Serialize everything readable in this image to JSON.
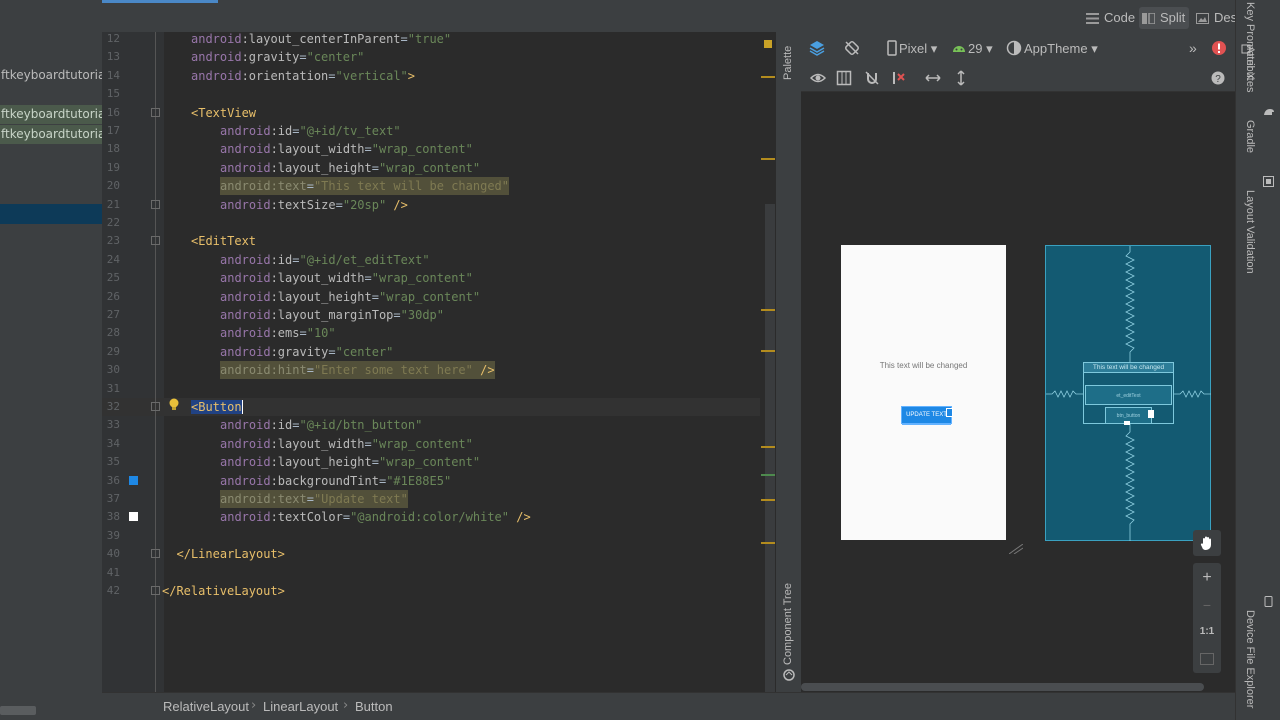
{
  "project_panel": {
    "items": [
      "ftkeyboardtutorial",
      "ftkeyboardtutorial",
      "ftkeyboardtutorial"
    ]
  },
  "view_modes": {
    "code": "Code",
    "split": "Split",
    "design": "Design",
    "active": "Split"
  },
  "editor": {
    "lines": [
      {
        "n": "12",
        "indent": 1,
        "parts": [
          [
            "ns",
            "android"
          ],
          [
            "attr",
            ":layout_centerInParent"
          ],
          [
            "plain",
            "="
          ],
          [
            "str",
            "\"true\""
          ]
        ]
      },
      {
        "n": "13",
        "indent": 1,
        "parts": [
          [
            "ns",
            "android"
          ],
          [
            "attr",
            ":gravity"
          ],
          [
            "plain",
            "="
          ],
          [
            "str",
            "\"center\""
          ]
        ]
      },
      {
        "n": "14",
        "indent": 1,
        "parts": [
          [
            "ns",
            "android"
          ],
          [
            "attr",
            ":orientation"
          ],
          [
            "plain",
            "="
          ],
          [
            "str",
            "\"vertical\""
          ],
          [
            "tag",
            ">"
          ]
        ]
      },
      {
        "n": "15",
        "indent": 0,
        "parts": []
      },
      {
        "n": "16",
        "indent": 1,
        "parts": [
          [
            "tag",
            "<TextView"
          ]
        ]
      },
      {
        "n": "17",
        "indent": 2,
        "parts": [
          [
            "ns",
            "android"
          ],
          [
            "attr",
            ":id"
          ],
          [
            "plain",
            "="
          ],
          [
            "str",
            "\"@+id/tv_text\""
          ]
        ]
      },
      {
        "n": "18",
        "indent": 2,
        "parts": [
          [
            "ns",
            "android"
          ],
          [
            "attr",
            ":layout_width"
          ],
          [
            "plain",
            "="
          ],
          [
            "str",
            "\"wrap_content\""
          ]
        ]
      },
      {
        "n": "19",
        "indent": 2,
        "parts": [
          [
            "ns",
            "android"
          ],
          [
            "attr",
            ":layout_height"
          ],
          [
            "plain",
            "="
          ],
          [
            "str",
            "\"wrap_content\""
          ]
        ]
      },
      {
        "n": "20",
        "indent": 2,
        "hl": true,
        "parts": [
          [
            "ns",
            "android"
          ],
          [
            "attr",
            ":text"
          ],
          [
            "plain",
            "="
          ],
          [
            "str",
            "\"This text will be changed\""
          ]
        ]
      },
      {
        "n": "21",
        "indent": 2,
        "parts": [
          [
            "ns",
            "android"
          ],
          [
            "attr",
            ":textSize"
          ],
          [
            "plain",
            "="
          ],
          [
            "str",
            "\"20sp\""
          ],
          [
            "tag",
            " />"
          ]
        ]
      },
      {
        "n": "22",
        "indent": 0,
        "parts": []
      },
      {
        "n": "23",
        "indent": 1,
        "parts": [
          [
            "tag",
            "<EditText"
          ]
        ]
      },
      {
        "n": "24",
        "indent": 2,
        "parts": [
          [
            "ns",
            "android"
          ],
          [
            "attr",
            ":id"
          ],
          [
            "plain",
            "="
          ],
          [
            "str",
            "\"@+id/et_editText\""
          ]
        ]
      },
      {
        "n": "25",
        "indent": 2,
        "parts": [
          [
            "ns",
            "android"
          ],
          [
            "attr",
            ":layout_width"
          ],
          [
            "plain",
            "="
          ],
          [
            "str",
            "\"wrap_content\""
          ]
        ]
      },
      {
        "n": "26",
        "indent": 2,
        "parts": [
          [
            "ns",
            "android"
          ],
          [
            "attr",
            ":layout_height"
          ],
          [
            "plain",
            "="
          ],
          [
            "str",
            "\"wrap_content\""
          ]
        ]
      },
      {
        "n": "27",
        "indent": 2,
        "parts": [
          [
            "ns",
            "android"
          ],
          [
            "attr",
            ":layout_marginTop"
          ],
          [
            "plain",
            "="
          ],
          [
            "str",
            "\"30dp\""
          ]
        ]
      },
      {
        "n": "28",
        "indent": 2,
        "parts": [
          [
            "ns",
            "android"
          ],
          [
            "attr",
            ":ems"
          ],
          [
            "plain",
            "="
          ],
          [
            "str",
            "\"10\""
          ]
        ]
      },
      {
        "n": "29",
        "indent": 2,
        "parts": [
          [
            "ns",
            "android"
          ],
          [
            "attr",
            ":gravity"
          ],
          [
            "plain",
            "="
          ],
          [
            "str",
            "\"center\""
          ]
        ]
      },
      {
        "n": "30",
        "indent": 2,
        "hl": true,
        "parts": [
          [
            "ns",
            "android"
          ],
          [
            "attr",
            ":hint"
          ],
          [
            "plain",
            "="
          ],
          [
            "str",
            "\"Enter some text here\""
          ],
          [
            "tag",
            " />"
          ]
        ]
      },
      {
        "n": "31",
        "indent": 0,
        "parts": []
      },
      {
        "n": "32",
        "indent": 1,
        "parts": [
          [
            "seltag",
            "<Button"
          ]
        ]
      },
      {
        "n": "33",
        "indent": 2,
        "parts": [
          [
            "ns",
            "android"
          ],
          [
            "attr",
            ":id"
          ],
          [
            "plain",
            "="
          ],
          [
            "str",
            "\"@+id/btn_button\""
          ]
        ]
      },
      {
        "n": "34",
        "indent": 2,
        "parts": [
          [
            "ns",
            "android"
          ],
          [
            "attr",
            ":layout_width"
          ],
          [
            "plain",
            "="
          ],
          [
            "str",
            "\"wrap_content\""
          ]
        ]
      },
      {
        "n": "35",
        "indent": 2,
        "parts": [
          [
            "ns",
            "android"
          ],
          [
            "attr",
            ":layout_height"
          ],
          [
            "plain",
            "="
          ],
          [
            "str",
            "\"wrap_content\""
          ]
        ]
      },
      {
        "n": "36",
        "indent": 2,
        "parts": [
          [
            "ns",
            "android"
          ],
          [
            "attr",
            ":backgroundTint"
          ],
          [
            "plain",
            "="
          ],
          [
            "str",
            "\"#1E88E5\""
          ]
        ]
      },
      {
        "n": "37",
        "indent": 2,
        "hl": true,
        "parts": [
          [
            "ns",
            "android"
          ],
          [
            "attr",
            ":text"
          ],
          [
            "plain",
            "="
          ],
          [
            "str",
            "\"Update text\""
          ]
        ]
      },
      {
        "n": "38",
        "indent": 2,
        "parts": [
          [
            "ns",
            "android"
          ],
          [
            "attr",
            ":textColor"
          ],
          [
            "plain",
            "="
          ],
          [
            "str",
            "\"@android:color/white\""
          ],
          [
            "tag",
            " />"
          ]
        ]
      },
      {
        "n": "39",
        "indent": 0,
        "parts": []
      },
      {
        "n": "40",
        "indent": 0.5,
        "parts": [
          [
            "tag",
            "</LinearLayout>"
          ]
        ]
      },
      {
        "n": "41",
        "indent": 0,
        "parts": []
      },
      {
        "n": "42",
        "indent": 0,
        "parts": [
          [
            "tag",
            "</RelativeLayout>"
          ]
        ]
      }
    ],
    "color_swatches": {
      "36": "#1E88E5",
      "38": "#FFFFFF"
    }
  },
  "side_panels": {
    "palette": "Palette",
    "component_tree": "Component Tree"
  },
  "design_toolbar": {
    "device": "Pixel",
    "api_level": "29",
    "theme": "AppTheme"
  },
  "preview": {
    "text": "This text will be changed",
    "button": "UPDATE TEXT",
    "button_color": "#1E88E5"
  },
  "blueprint": {
    "text": "This text will be changed",
    "edit_text": "et_editText",
    "button": "btn_button"
  },
  "zoom": {
    "plus": "+",
    "minus": "−",
    "one_to_one": "1:1"
  },
  "right_tools": [
    "Key Promoter X",
    "Attributes",
    "Gradle",
    "Layout Validation",
    "Device File Explorer"
  ],
  "breadcrumb": [
    "RelativeLayout",
    "LinearLayout",
    "Button"
  ]
}
